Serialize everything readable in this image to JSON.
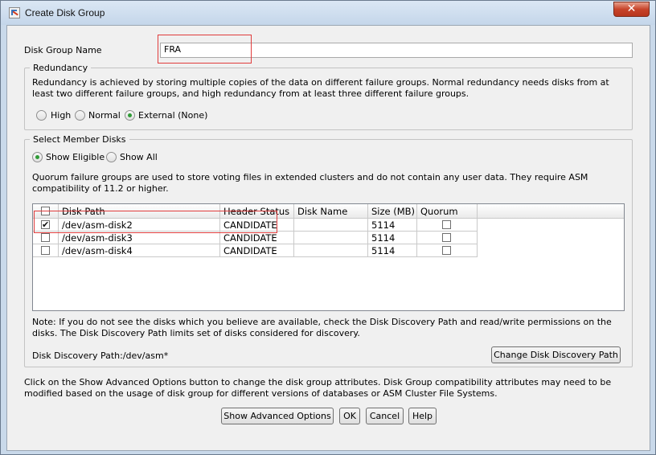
{
  "window": {
    "title": "Create Disk Group",
    "close_glyph": "✕"
  },
  "disk_group_name": {
    "label": "Disk Group Name",
    "value": "FRA"
  },
  "redundancy": {
    "legend": "Redundancy",
    "description": "Redundancy is achieved by storing multiple copies of the data on different failure groups. Normal redundancy needs disks from at least two different failure groups, and high redundancy from at least three different failure groups.",
    "options": [
      {
        "label": "High",
        "selected": false
      },
      {
        "label": "Normal",
        "selected": false
      },
      {
        "label": "External (None)",
        "selected": true
      }
    ]
  },
  "member_disks": {
    "legend": "Select Member Disks",
    "filters": [
      {
        "label": "Show Eligible",
        "selected": true
      },
      {
        "label": "Show All",
        "selected": false
      }
    ],
    "quorum_note": "Quorum failure groups are used to store voting files in extended clusters and do not contain any user data. They require ASM compatibility of 11.2 or higher.",
    "table": {
      "columns": [
        "Disk Path",
        "Header Status",
        "Disk Name",
        "Size (MB)",
        "Quorum"
      ],
      "rows": [
        {
          "selected": true,
          "path": "/dev/asm-disk2",
          "status": "CANDIDATE",
          "name": "",
          "size": "5114",
          "quorum": false
        },
        {
          "selected": false,
          "path": "/dev/asm-disk3",
          "status": "CANDIDATE",
          "name": "",
          "size": "5114",
          "quorum": false
        },
        {
          "selected": false,
          "path": "/dev/asm-disk4",
          "status": "CANDIDATE",
          "name": "",
          "size": "5114",
          "quorum": false
        }
      ]
    },
    "discovery_note": "Note: If you do not see the disks which you believe are available, check the Disk Discovery Path and read/write permissions on the disks. The Disk Discovery Path limits set of disks considered for discovery.",
    "discovery_path": "Disk Discovery Path:/dev/asm*",
    "change_path_button": "Change Disk Discovery Path"
  },
  "advanced_note": "Click on the Show Advanced Options button to change the disk group attributes. Disk Group compatibility attributes may need to be modified based on the usage of disk group for different versions of databases or ASM Cluster File Systems.",
  "buttons": {
    "advanced": "Show Advanced Options",
    "ok": "OK",
    "cancel": "Cancel",
    "help": "Help"
  },
  "colors": {
    "highlight_box": "#e03c3c",
    "radio_selected": "#2f9b36",
    "close_button": "#c7442a"
  }
}
